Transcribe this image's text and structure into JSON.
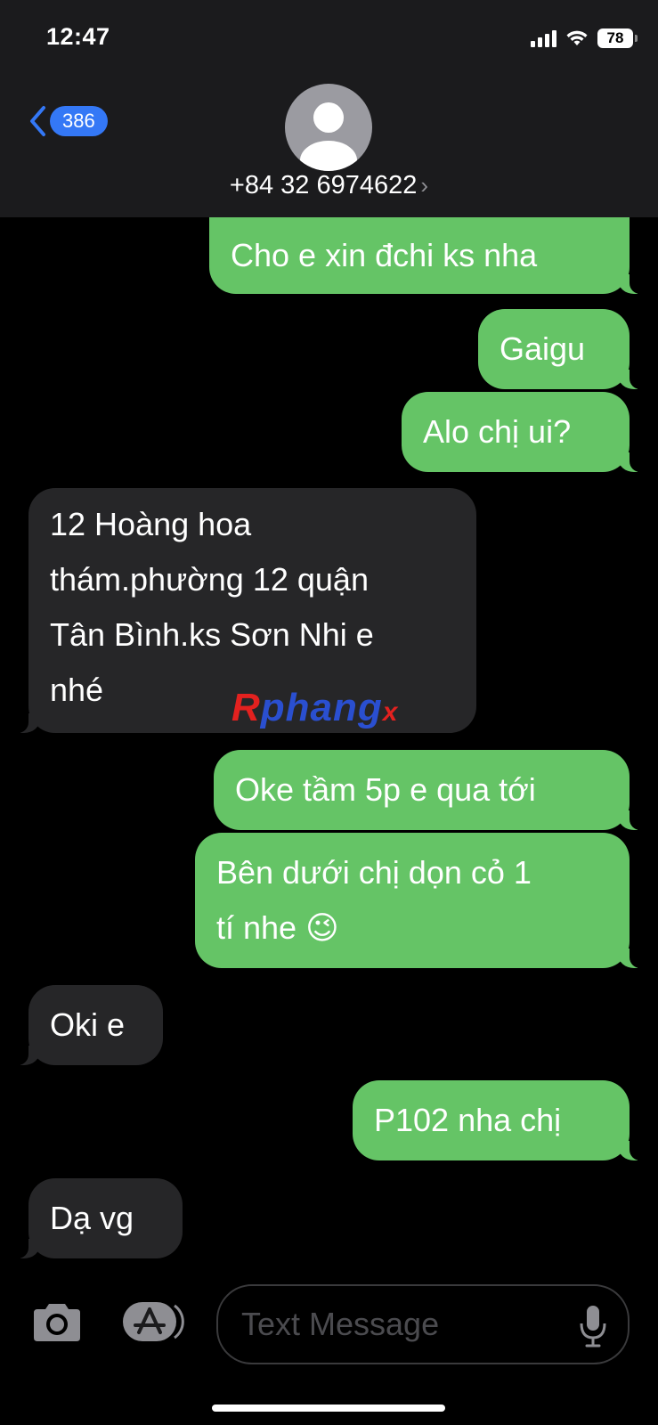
{
  "status": {
    "time": "12:47",
    "battery": "78"
  },
  "header": {
    "back_count": "386",
    "contact": "+84 32 6974622",
    "contact_chevron": "›"
  },
  "messages": [
    {
      "from": "me",
      "lines": [
        "Cho e xin đchi ks nha"
      ]
    },
    {
      "from": "me",
      "lines": [
        "Gaigu"
      ]
    },
    {
      "from": "me",
      "lines": [
        "Alo chị ui?"
      ]
    },
    {
      "from": "them",
      "lines": [
        "12 Hoàng hoa",
        "thám.phường 12 quận",
        "Tân Bình.ks Sơn Nhi e",
        "nhé"
      ]
    },
    {
      "from": "me",
      "lines": [
        "Oke tầm 5p e qua tới"
      ]
    },
    {
      "from": "me",
      "lines": [
        "Bên dưới chị dọn cỏ 1",
        "tí nhe 😉"
      ]
    },
    {
      "from": "them",
      "lines": [
        "Oki e"
      ]
    },
    {
      "from": "me",
      "lines": [
        "P102 nha chị"
      ]
    },
    {
      "from": "them",
      "lines": [
        "Dạ vg"
      ]
    }
  ],
  "watermark": {
    "part1": "R",
    "part2": "phang",
    "part3": "x"
  },
  "composer": {
    "placeholder": "Text Message"
  },
  "colors": {
    "sent_bubble": "#65c466",
    "received_bubble": "#262628",
    "back_accent": "#3478f6",
    "header_bg": "#1b1b1d"
  }
}
